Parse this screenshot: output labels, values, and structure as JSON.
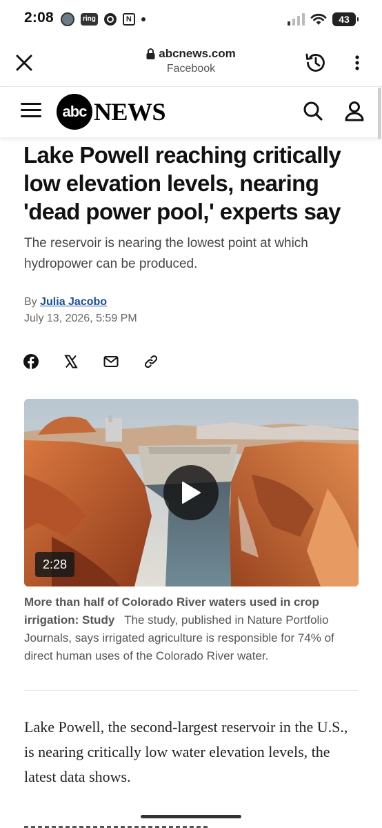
{
  "status_bar": {
    "time": "2:08",
    "ring_label": "ring",
    "n_label": "N",
    "battery": "43"
  },
  "browser": {
    "domain": "abcnews.com",
    "referrer": "Facebook",
    "icons": [
      "close-icon",
      "lock-icon",
      "history-icon",
      "more-vert-icon"
    ]
  },
  "site": {
    "logo_text": "abc",
    "brand_word": "NEWS",
    "icons": [
      "hamburger-menu-icon",
      "search-icon",
      "user-icon"
    ]
  },
  "article": {
    "headline": "Lake Powell reaching critically low elevation levels, nearing 'dead power pool,' experts say",
    "subheadline": "The reservoir is nearing the lowest point at which hydropower can be produced.",
    "by_prefix": "By",
    "author": "Julia Jacobo",
    "date": "July 13, 2026, 5:59 PM",
    "share_icons": [
      "facebook-icon",
      "x-icon",
      "email-icon",
      "link-icon"
    ]
  },
  "video": {
    "duration": "2:28",
    "caption_title": "More than half of Colorado River waters used in crop irrigation: Study",
    "caption_text": "The study, published in Nature Portfolio Journals, says irrigated agriculture is responsible for 74% of direct human uses of the Colorado River water."
  },
  "body": {
    "paragraph_1": "Lake Powell, the second-largest reservoir in the U.S., is nearing critically low water elevation levels, the latest data shows."
  },
  "colors": {
    "author_link": "#1a4ca0",
    "headline": "#111111",
    "canyon_rock": "#c8602e"
  }
}
